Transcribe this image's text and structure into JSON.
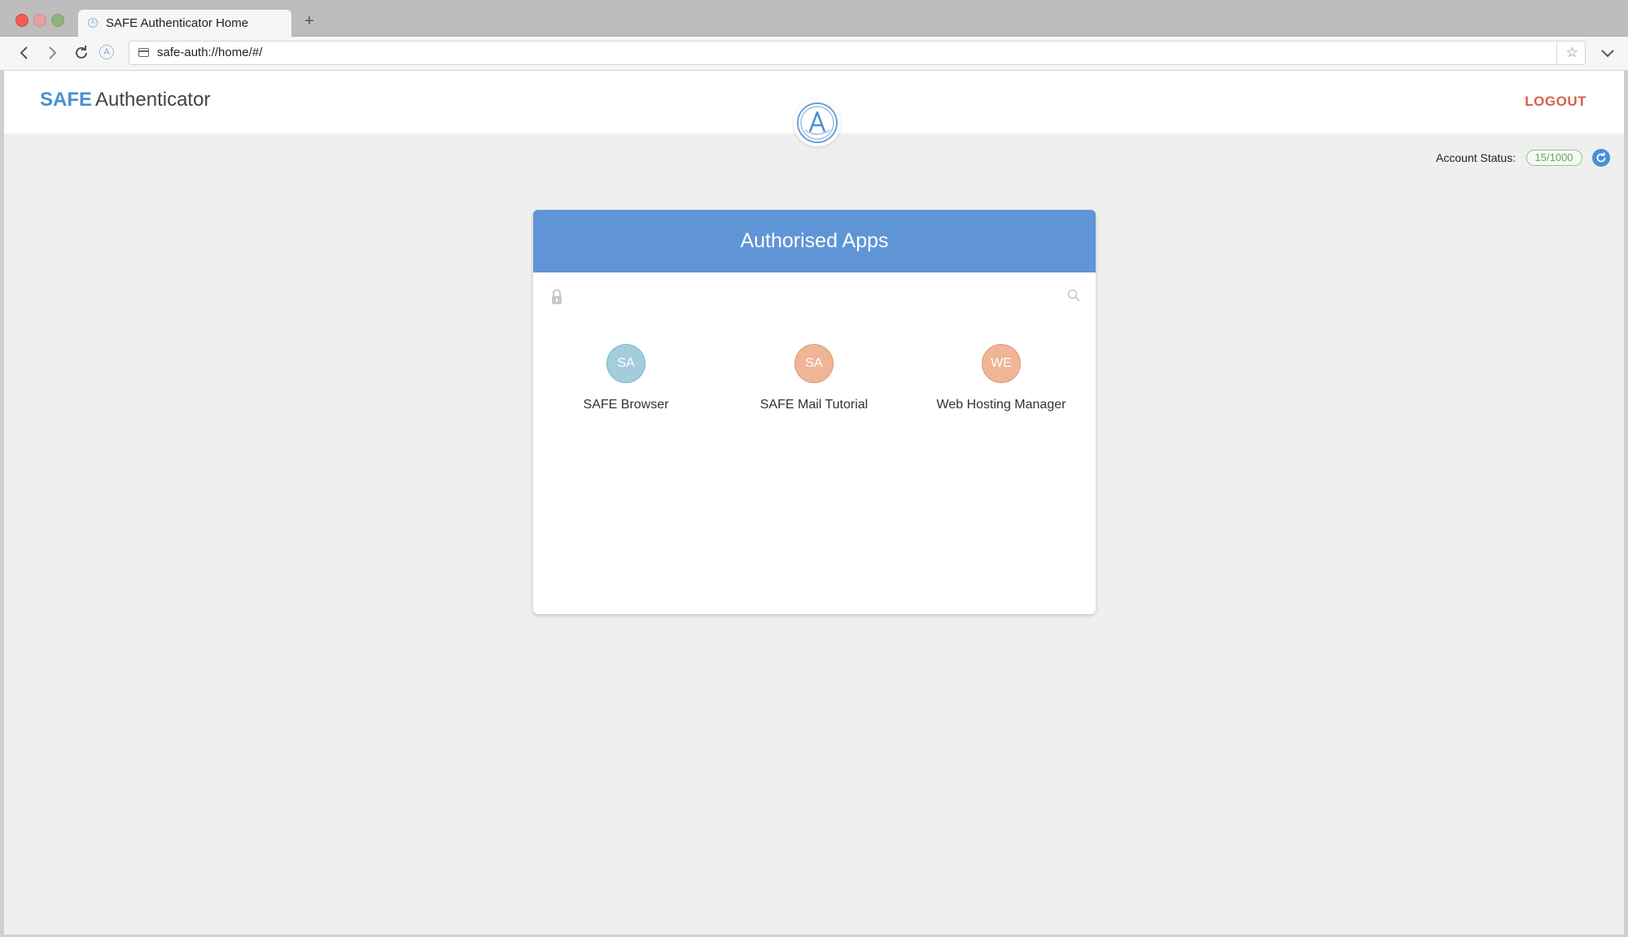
{
  "browser": {
    "tab_title": "SAFE Authenticator Home",
    "new_tab_glyph": "+",
    "url": "safe-auth://home/#/",
    "icons": [
      "back-icon",
      "forward-icon",
      "reload-icon",
      "safe-logo-icon",
      "page-icon",
      "star-icon",
      "chevron-down-icon"
    ]
  },
  "header": {
    "brand_safe": "SAFE",
    "brand_rest": "Authenticator",
    "logo_letter": "A",
    "logout_label": "LOGOUT"
  },
  "account": {
    "label": "Account Status:",
    "value": "15/1000",
    "refresh_icon": "refresh-icon"
  },
  "card": {
    "title": "Authorised Apps",
    "apps": [
      {
        "initials": "SA",
        "name": "SAFE Browser",
        "color": "#a3cddb",
        "border": "#7db4c7"
      },
      {
        "initials": "SA",
        "name": "SAFE Mail Tutorial",
        "color": "#efb596",
        "border": "#d99a78"
      },
      {
        "initials": "WE",
        "name": "Web Hosting Manager",
        "color": "#efb596",
        "border": "#d99a78"
      }
    ]
  },
  "colors": {
    "accent": "#5f95d6",
    "brand_blue": "#4a8fd6",
    "logout_red": "#d95e4f",
    "status_green": "#8fc68c"
  }
}
